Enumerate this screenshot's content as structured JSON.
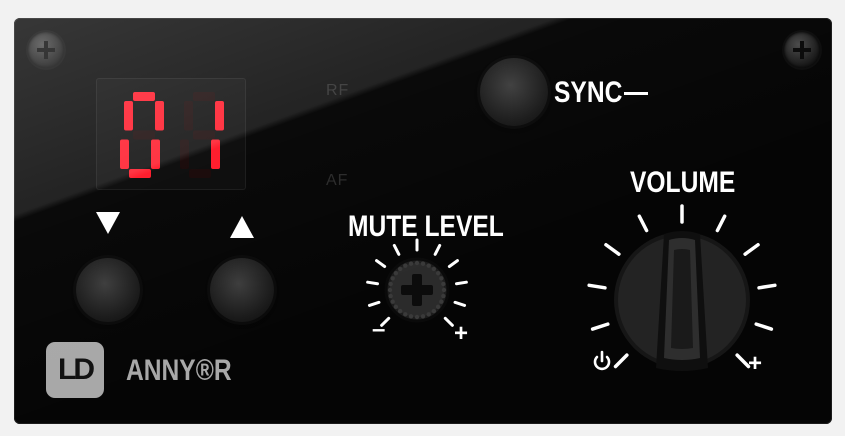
{
  "display": {
    "channel": "01",
    "indicator_rf": "RF",
    "indicator_af": "AF",
    "segment_color": "#ff1a2a"
  },
  "controls": {
    "sync_label": "SYNC",
    "mute_level_label": "MUTE LEVEL",
    "mute_min": "–",
    "mute_max": "+",
    "volume_label": "VOLUME",
    "volume_min_icon": "power-icon",
    "volume_max": "+"
  },
  "brand": {
    "logo": "LD",
    "product": "ANNY®R"
  },
  "icons": {
    "down": "triangle-down-icon",
    "up": "triangle-up-icon",
    "screw": "screw-icon"
  }
}
